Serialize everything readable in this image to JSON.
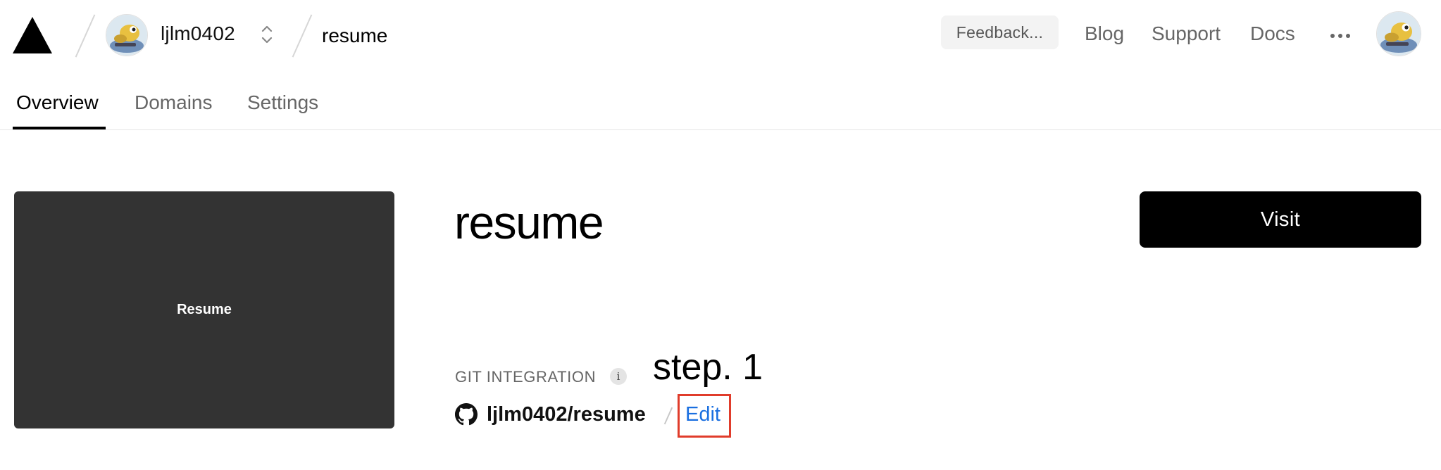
{
  "header": {
    "team_name": "ljlm0402",
    "project_name": "resume",
    "feedback_label": "Feedback...",
    "nav": {
      "blog": "Blog",
      "support": "Support",
      "docs": "Docs"
    },
    "icons": {
      "logo": "triangle-logo-icon",
      "switcher": "chevron-up-down-icon",
      "more": "ellipsis-icon"
    }
  },
  "tabs": [
    {
      "label": "Overview",
      "active": true
    },
    {
      "label": "Domains",
      "active": false
    },
    {
      "label": "Settings",
      "active": false
    }
  ],
  "main": {
    "preview_text": "Resume",
    "project_title": "resume",
    "visit_label": "Visit",
    "git": {
      "label": "GIT INTEGRATION",
      "info_icon_text": "i",
      "repo": "ljlm0402/resume",
      "edit_label": "Edit"
    },
    "annotation": "step. 1"
  },
  "colors": {
    "accent_link": "#1a6fe0",
    "highlight_border": "#e03c2b",
    "preview_bg": "#333333",
    "button_bg": "#000000"
  }
}
